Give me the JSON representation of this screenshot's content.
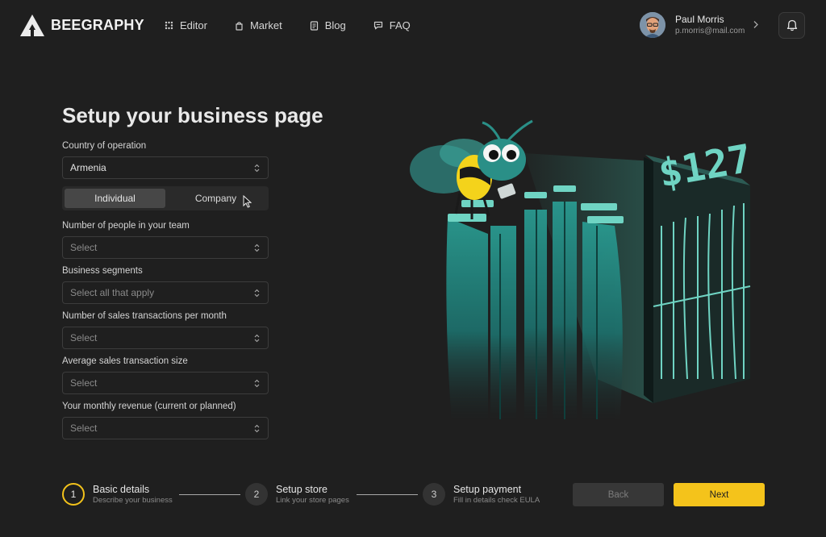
{
  "header": {
    "brand": "BEEGRAPHY",
    "nav": [
      {
        "label": "Editor",
        "icon": "grid-dots-icon"
      },
      {
        "label": "Market",
        "icon": "bag-icon"
      },
      {
        "label": "Blog",
        "icon": "document-icon"
      },
      {
        "label": "FAQ",
        "icon": "chat-icon"
      }
    ],
    "user": {
      "name": "Paul Morris",
      "email": "p.morris@mail.com"
    }
  },
  "form": {
    "title": "Setup your business page",
    "country": {
      "label": "Country of operation",
      "value": "Armenia"
    },
    "account_type": {
      "options": [
        "Individual",
        "Company"
      ],
      "selected": "Individual"
    },
    "team_size": {
      "label": "Number of people in your team",
      "placeholder": "Select"
    },
    "segments": {
      "label": "Business segments",
      "placeholder": "Select all that apply"
    },
    "transactions": {
      "label": "Number of sales transactions per month",
      "placeholder": "Select"
    },
    "avg_size": {
      "label": "Average sales transaction size",
      "placeholder": "Select"
    },
    "revenue": {
      "label": "Your monthly revenue (current or planned)",
      "placeholder": "Select"
    }
  },
  "steps": [
    {
      "num": "1",
      "title": "Basic details",
      "sub": "Describe your business",
      "active": true
    },
    {
      "num": "2",
      "title": "Setup store",
      "sub": "Link your store pages",
      "active": false
    },
    {
      "num": "3",
      "title": "Setup payment",
      "sub": "Fill in details check EULA",
      "active": false
    }
  ],
  "buttons": {
    "back": "Back",
    "next": "Next"
  },
  "illustration": {
    "price": "$127"
  },
  "colors": {
    "accent": "#f4c31b",
    "teal": "#1f8c84",
    "background": "#1f1f1f"
  }
}
